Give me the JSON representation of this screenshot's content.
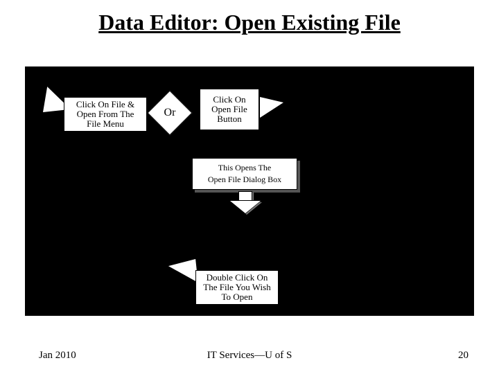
{
  "title": "Data Editor: Open Existing File",
  "callouts": {
    "file_menu": "Click On File & Open From The File Menu",
    "or": "Or",
    "open_button": "Click On Open File Button",
    "opens_line1": "This Opens The",
    "opens_line2": "Open File Dialog Box",
    "double_click": "Double Click On The File You Wish To Open"
  },
  "footer": {
    "date": "Jan 2010",
    "center": "IT Services—U of S",
    "page": "20"
  }
}
